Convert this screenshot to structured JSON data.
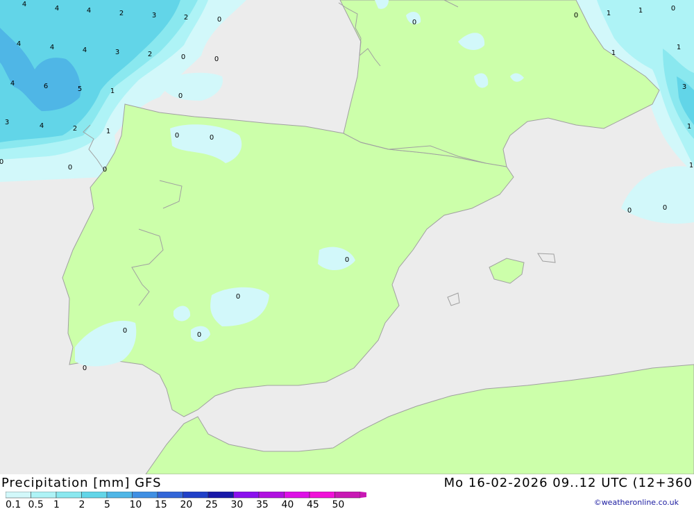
{
  "title": {
    "product": "Precipitation [mm]",
    "model": "GFS",
    "datetime": "Mo 16-02-2026 09..12 UTC (12+360"
  },
  "credit": "©weatheronline.co.uk",
  "colors": {
    "sea": "#ececec",
    "land": "#ccffaa",
    "coast": "#a0a0a0"
  },
  "legend": {
    "ticks": [
      "0.1",
      "0.5",
      "1",
      "2",
      "5",
      "10",
      "15",
      "20",
      "25",
      "30",
      "35",
      "40",
      "45",
      "50"
    ],
    "colors": [
      "#d2f8fa",
      "#aef3f6",
      "#8ae8ef",
      "#62d5e8",
      "#4fb6e6",
      "#3f8fe3",
      "#3366d8",
      "#2040c8",
      "#1818a8",
      "#8a10ee",
      "#b010e0",
      "#dd10e6",
      "#f010d8",
      "#c818b4"
    ]
  },
  "map_values": [
    "4",
    "4",
    "4",
    "2",
    "3",
    "2",
    "0",
    "4",
    "4",
    "4",
    "3",
    "2",
    "0",
    "0",
    "4",
    "6",
    "5",
    "1",
    "0",
    "3",
    "4",
    "2",
    "1",
    "0",
    "0",
    "0",
    "0",
    "0",
    "0",
    "0",
    "0",
    "0",
    "0",
    "0",
    "0",
    "1",
    "1",
    "0",
    "1",
    "1",
    "3",
    "1",
    "1",
    "0",
    "0"
  ]
}
